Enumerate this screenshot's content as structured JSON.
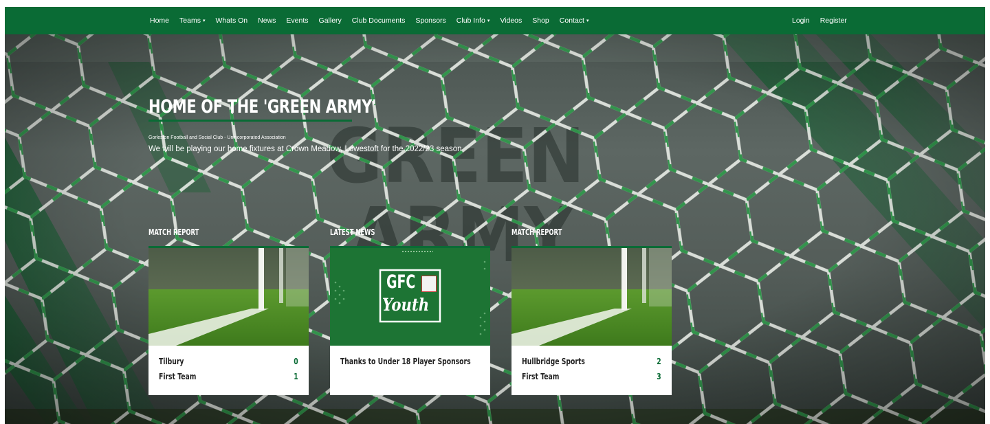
{
  "nav": {
    "left": [
      {
        "label": "Home",
        "dropdown": false
      },
      {
        "label": "Teams",
        "dropdown": true
      },
      {
        "label": "Whats On",
        "dropdown": false
      },
      {
        "label": "News",
        "dropdown": false
      },
      {
        "label": "Events",
        "dropdown": false
      },
      {
        "label": "Gallery",
        "dropdown": false
      },
      {
        "label": "Club Documents",
        "dropdown": false
      },
      {
        "label": "Sponsors",
        "dropdown": false
      },
      {
        "label": "Club Info",
        "dropdown": true
      },
      {
        "label": "Videos",
        "dropdown": false
      },
      {
        "label": "Shop",
        "dropdown": false
      },
      {
        "label": "Contact",
        "dropdown": true
      }
    ],
    "right": [
      {
        "label": "Login"
      },
      {
        "label": "Register"
      }
    ],
    "caret_icon": "▾"
  },
  "hero": {
    "title": "HOME OF THE 'GREEN ARMY'",
    "subtitle_small": "Gorleston Football and Social Club - Unincorporated Association",
    "subtitle": "We will be playing our home fixtures at Crown Meadow, Lowestoft for the 2022/23 season"
  },
  "cards": [
    {
      "label": "MATCH REPORT",
      "type": "match",
      "image": "goal-grass-image",
      "rows": [
        {
          "team": "Tilbury",
          "score": "0"
        },
        {
          "team": "First Team",
          "score": "1"
        }
      ]
    },
    {
      "label": "LATEST NEWS",
      "type": "news",
      "image": "gfc-youth-image",
      "logo_top": "GFC",
      "logo_bottom": "Youth",
      "title": "Thanks to Under 18 Player Sponsors"
    },
    {
      "label": "MATCH REPORT",
      "type": "match",
      "image": "goal-grass-image",
      "rows": [
        {
          "team": "Hullbridge Sports",
          "score": "2"
        },
        {
          "team": "First Team",
          "score": "3"
        }
      ]
    }
  ],
  "colors": {
    "brand_green": "#0a6b35",
    "white": "#ffffff"
  }
}
